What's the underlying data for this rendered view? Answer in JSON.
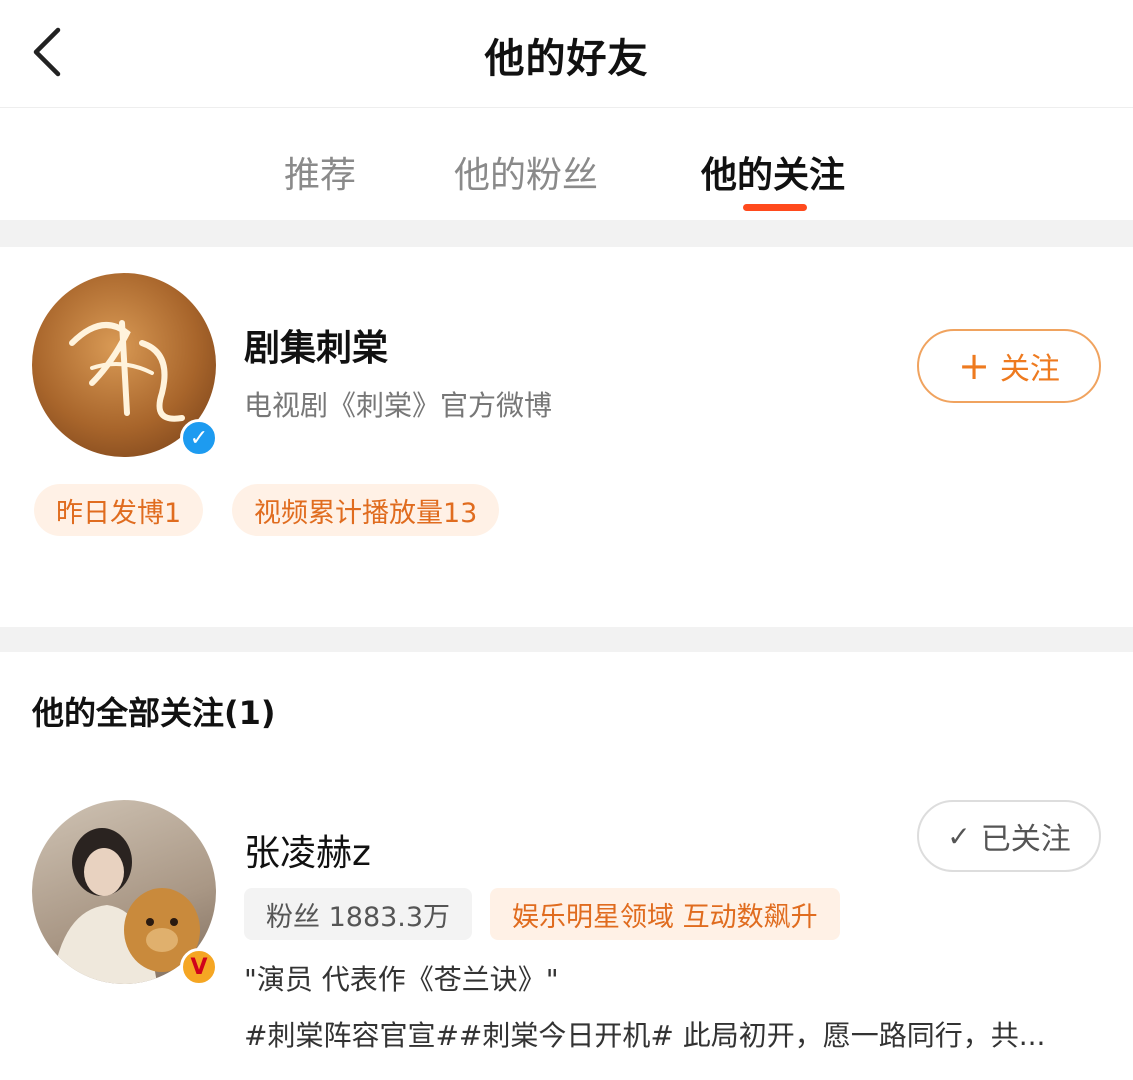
{
  "header": {
    "title": "他的好友",
    "back_icon": "chevron-left-icon"
  },
  "tabs": [
    {
      "label": "推荐",
      "active": false
    },
    {
      "label": "他的粉丝",
      "active": false
    },
    {
      "label": "他的关注",
      "active": true
    }
  ],
  "accent_color": "#ff4a1d",
  "recommended": {
    "name": "剧集刺棠",
    "description": "电视剧《刺棠》官方微博",
    "avatar_icon": "drama-poster-avatar",
    "verified_color": "#1d9bf0",
    "follow_button": "关注",
    "tags": [
      "昨日发博1",
      "视频累计播放量13"
    ]
  },
  "following": {
    "section_title": "他的全部关注(1)",
    "user": {
      "name": "张凌赫z",
      "avatar_icon": "person-with-dog-avatar",
      "verified_color": "#f5a623",
      "follow_button": "已关注",
      "fans_label": "粉丝 1883.3万",
      "badge_tag": "娱乐明星领域 互动数飙升",
      "bio": "\"演员 代表作《苍兰诀》\"",
      "latest_post": "#刺棠阵容官宣##刺棠今日开机# 此局初开，愿一路同行，共..."
    }
  }
}
